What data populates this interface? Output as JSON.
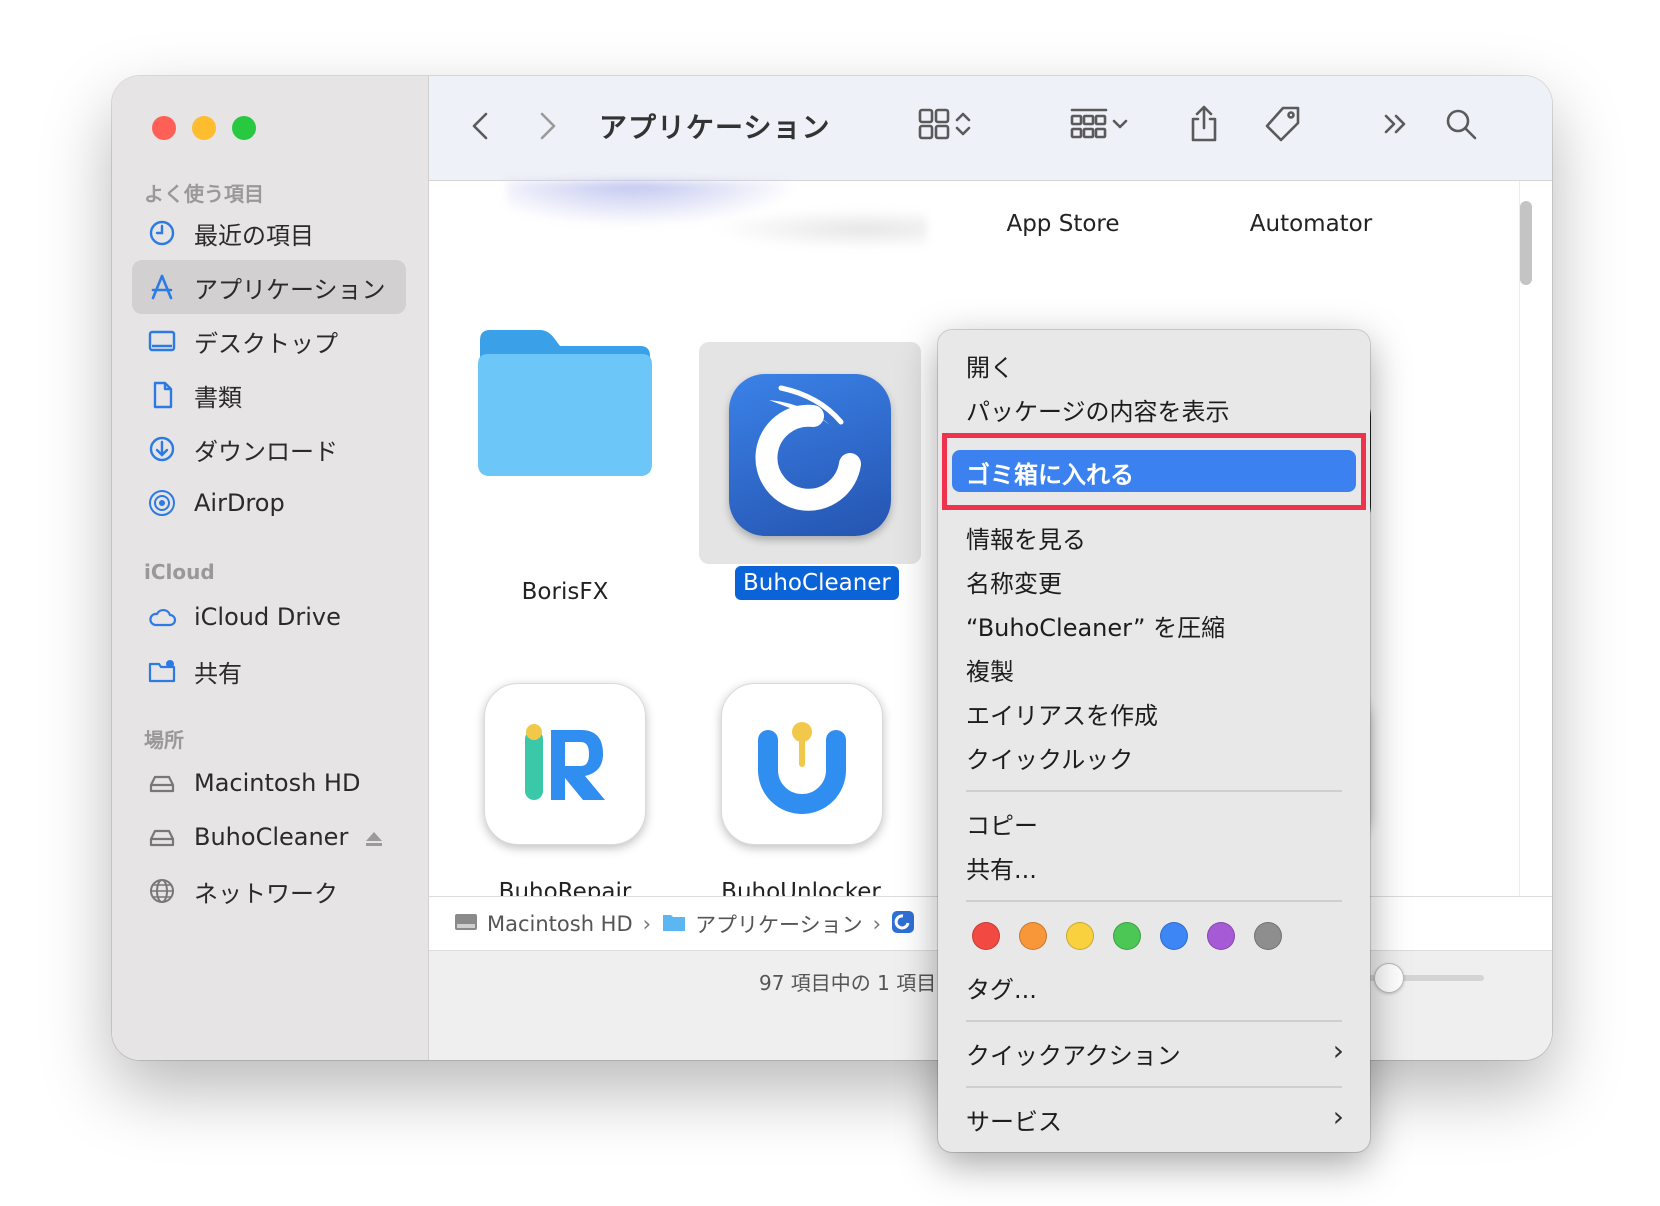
{
  "sidebar": {
    "favorites_label": "よく使う項目",
    "favorites": [
      {
        "label": "最近の項目",
        "icon": "clock-icon"
      },
      {
        "label": "アプリケーション",
        "icon": "applications-icon"
      },
      {
        "label": "デスクトップ",
        "icon": "desktop-icon"
      },
      {
        "label": "書類",
        "icon": "document-icon"
      },
      {
        "label": "ダウンロード",
        "icon": "download-icon"
      },
      {
        "label": "AirDrop",
        "icon": "airdrop-icon"
      }
    ],
    "icloud_label": "iCloud",
    "icloud": [
      {
        "label": "iCloud Drive",
        "icon": "cloud-icon"
      },
      {
        "label": "共有",
        "icon": "shared-folder-icon"
      }
    ],
    "locations_label": "場所",
    "locations": [
      {
        "label": "Macintosh HD",
        "icon": "disk-icon"
      },
      {
        "label": "BuhoCleaner",
        "icon": "disk-icon"
      },
      {
        "label": "ネットワーク",
        "icon": "globe-icon"
      }
    ]
  },
  "toolbar": {
    "title": "アプリケーション"
  },
  "content": {
    "top_labels": [
      "App Store",
      "Automator"
    ],
    "apps": [
      {
        "label": "BorisFX"
      },
      {
        "label": "BuhoCleaner",
        "selected": true
      },
      {
        "label": "BuhoRepair"
      },
      {
        "label": "BuhoUnlocker"
      }
    ]
  },
  "pathbar": {
    "items": [
      "Macintosh HD",
      "アプリケーション"
    ]
  },
  "status": {
    "text": "97 項目中の 1 項目"
  },
  "context_menu": {
    "items": [
      "開く",
      "パッケージの内容を表示",
      "ゴミ箱に入れる",
      "情報を見る",
      "名称変更",
      "“BuhoCleaner” を圧縮",
      "複製",
      "エイリアスを作成",
      "クイックルック",
      "コピー",
      "共有...",
      "タグ...",
      "クイックアクション",
      "サービス"
    ],
    "highlighted": "ゴミ箱に入れる",
    "tag_colors": [
      "#f24a43",
      "#f7973a",
      "#f9d13f",
      "#4cc654",
      "#3d86f5",
      "#a65ad6",
      "#8e8e8e"
    ]
  }
}
